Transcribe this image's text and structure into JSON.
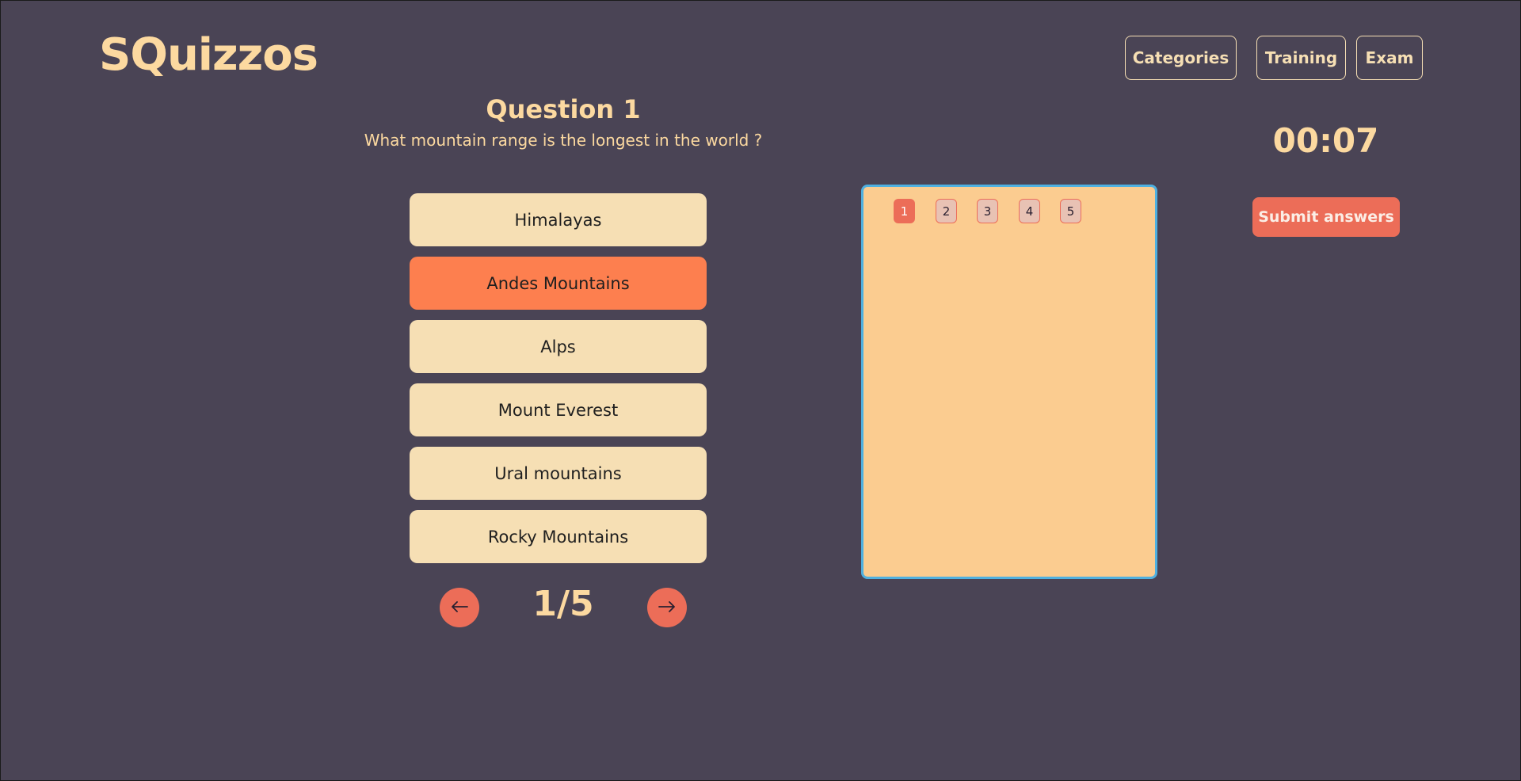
{
  "app": {
    "logo": "SQuizzos"
  },
  "nav": {
    "categories": "Categories",
    "training": "Training",
    "exam": "Exam"
  },
  "question": {
    "title": "Question 1",
    "text": "What mountain range is the longest in the world ?"
  },
  "answers": [
    {
      "label": "Himalayas",
      "selected": false
    },
    {
      "label": "Andes Mountains",
      "selected": true
    },
    {
      "label": "Alps",
      "selected": false
    },
    {
      "label": "Mount Everest",
      "selected": false
    },
    {
      "label": "Ural mountains",
      "selected": false
    },
    {
      "label": "Rocky Mountains",
      "selected": false
    }
  ],
  "pager": {
    "prev_icon": "arrow-left-icon",
    "next_icon": "arrow-right-icon",
    "counter": "1/5"
  },
  "question_panel": {
    "numbers": [
      "1",
      "2",
      "3",
      "4",
      "5"
    ],
    "current": "1"
  },
  "timer": {
    "value": "00:07"
  },
  "submit": {
    "label": "Submit answers"
  },
  "colors": {
    "background": "#4a4455",
    "accent_text": "#fcd9a0",
    "answer_bg": "#f6dfb4",
    "answer_selected": "#fd7f4f",
    "button_red": "#ec6d58",
    "panel_bg": "#fbcc90",
    "panel_border": "#4fb0e0"
  }
}
